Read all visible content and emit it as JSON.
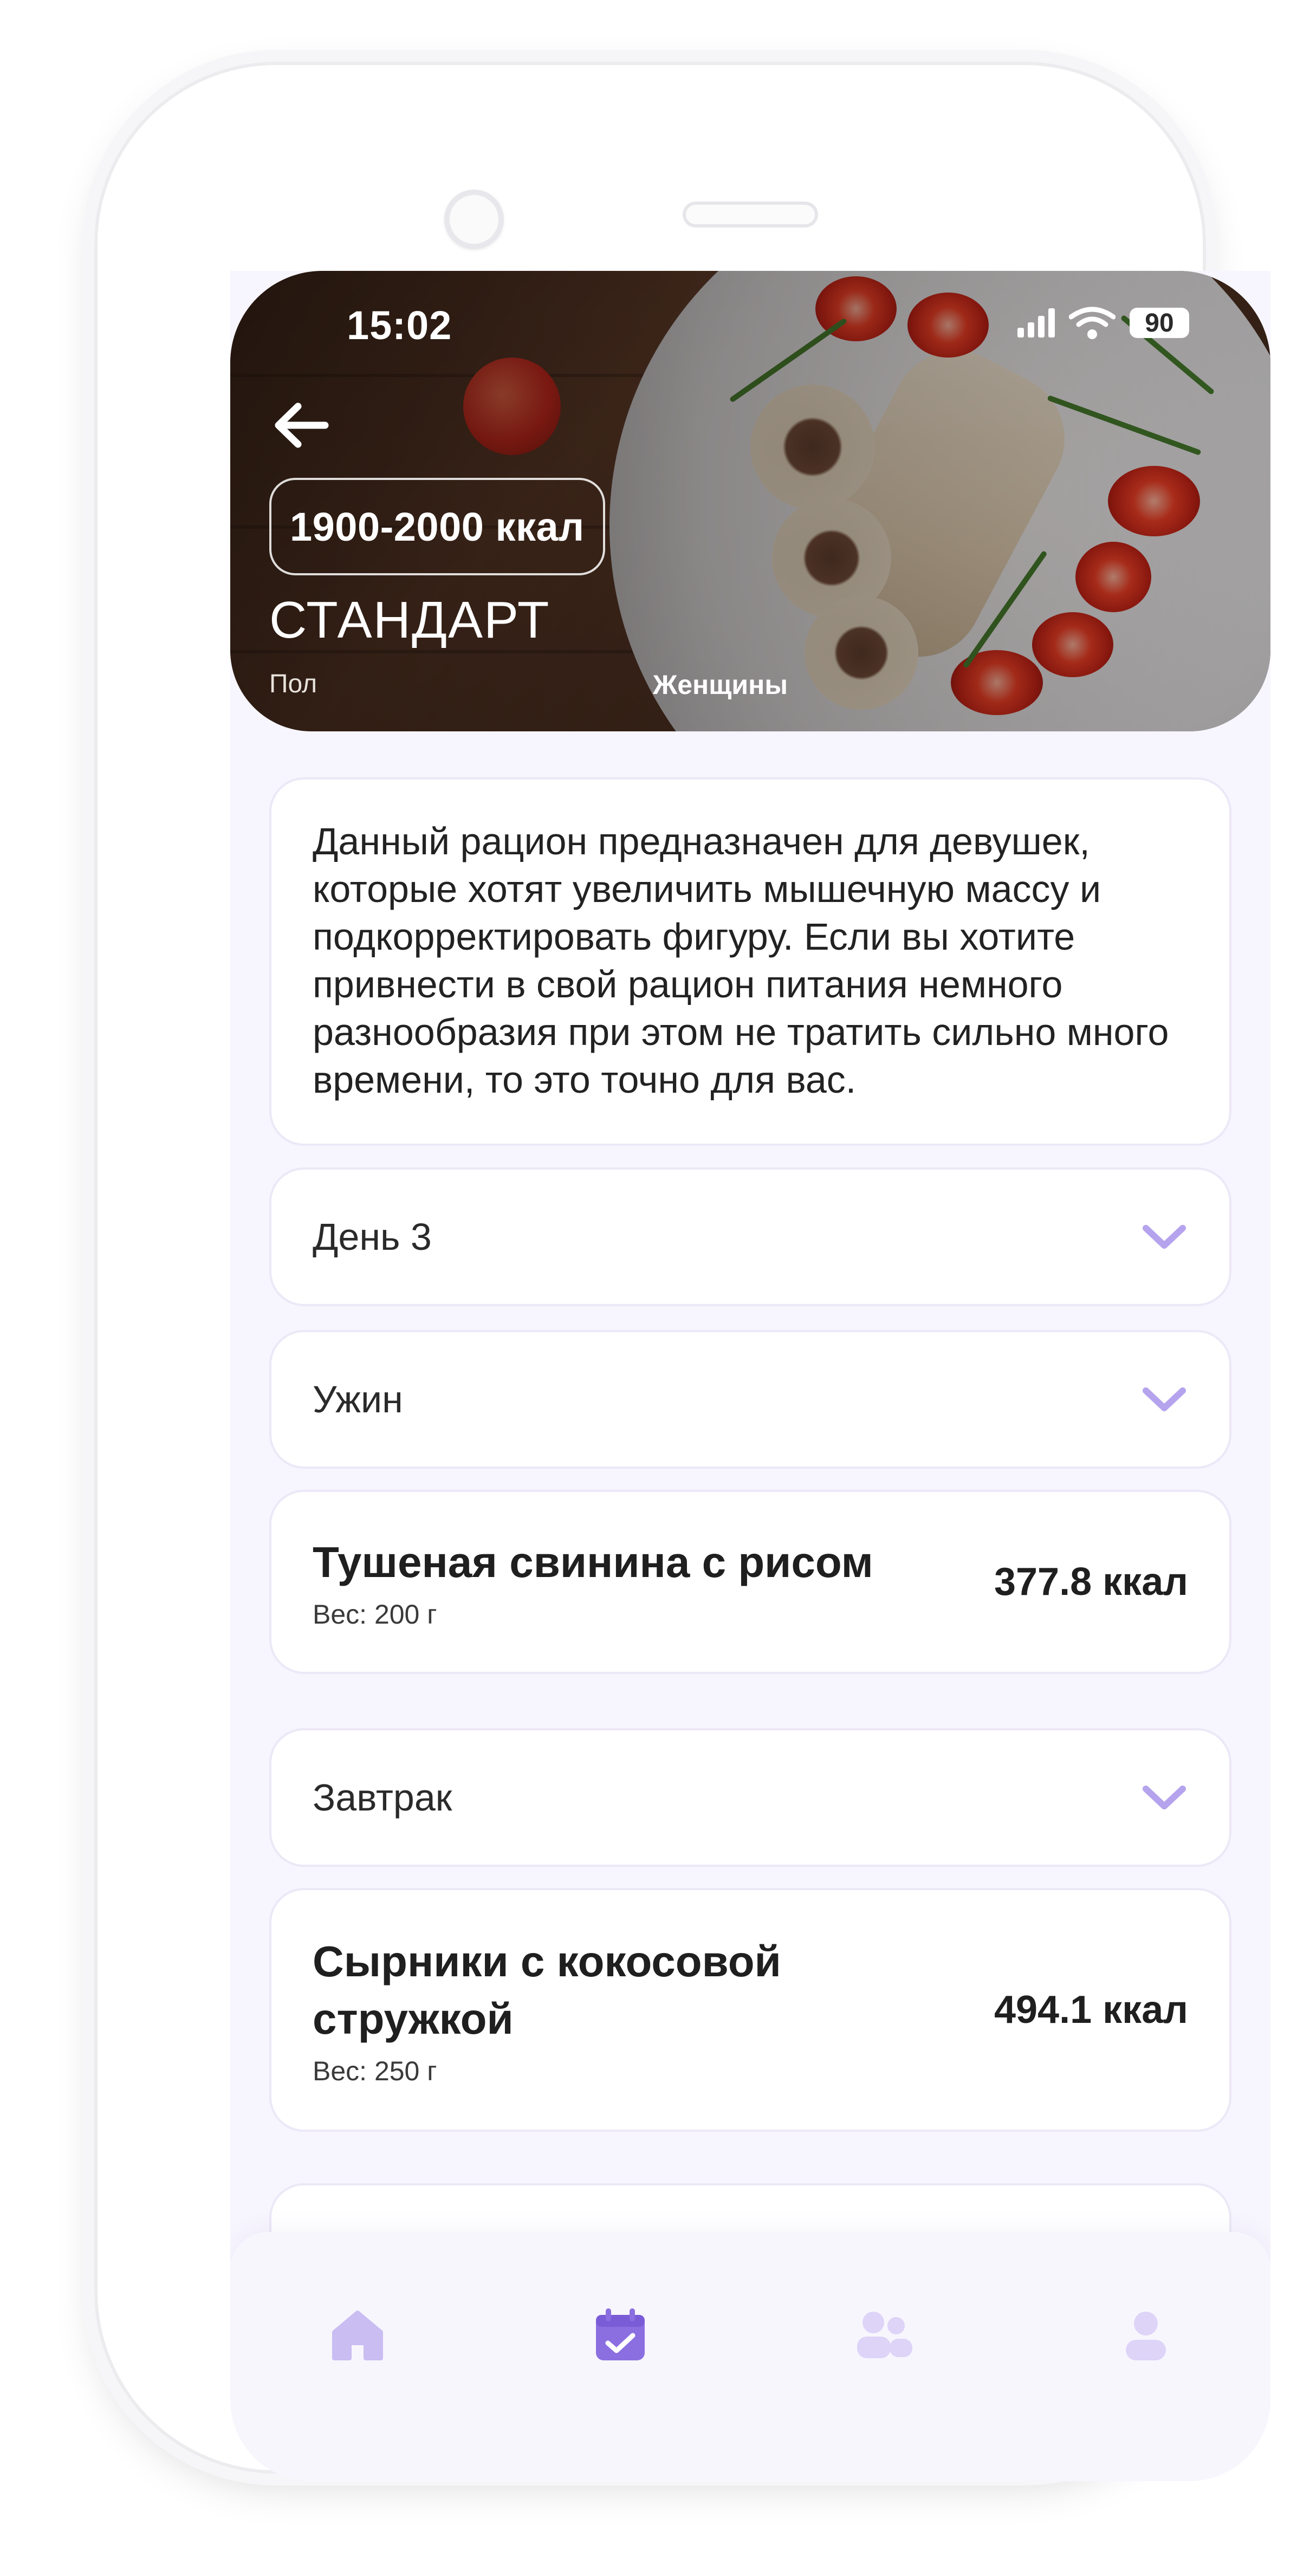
{
  "status_bar": {
    "time": "15:02",
    "battery": "90"
  },
  "plan": {
    "calories_range": "1900-2000 ккал",
    "title": "СТАНДАРТ",
    "sex_label": "Пол",
    "sex_value": "Женщины"
  },
  "description": "Данный рацион предназначен для девушек, которые хотят увеличить мышечную массу и подкорректировать фигуру. Если вы хотите привнести в свой рацион питания немного разнообразия при этом не тратить сильно много времени, то это точно для вас.",
  "day_selector": {
    "label": "День 3"
  },
  "meals": [
    {
      "section": "Ужин",
      "dish": {
        "name": "Тушеная свинина с рисом",
        "weight": "Вес: 200 г",
        "calories": "377.8 ккал"
      }
    },
    {
      "section": "Завтрак",
      "dish": {
        "name": "Сырники с кокосовой стружкой",
        "weight": "Вес: 250 г",
        "calories": "494.1 ккал"
      }
    }
  ],
  "tab_bar": {
    "items": [
      {
        "icon": "home-icon",
        "active": false
      },
      {
        "icon": "calendar-check-icon",
        "active": true
      },
      {
        "icon": "users-icon",
        "active": false
      },
      {
        "icon": "user-icon",
        "active": false
      }
    ]
  },
  "colors": {
    "accent": "#8b6fe0",
    "accent_light": "#c9bdf2",
    "chevron": "#b5a3ee",
    "background": "#f7f5fd",
    "card_border": "#ece8f7",
    "text": "#222222"
  }
}
